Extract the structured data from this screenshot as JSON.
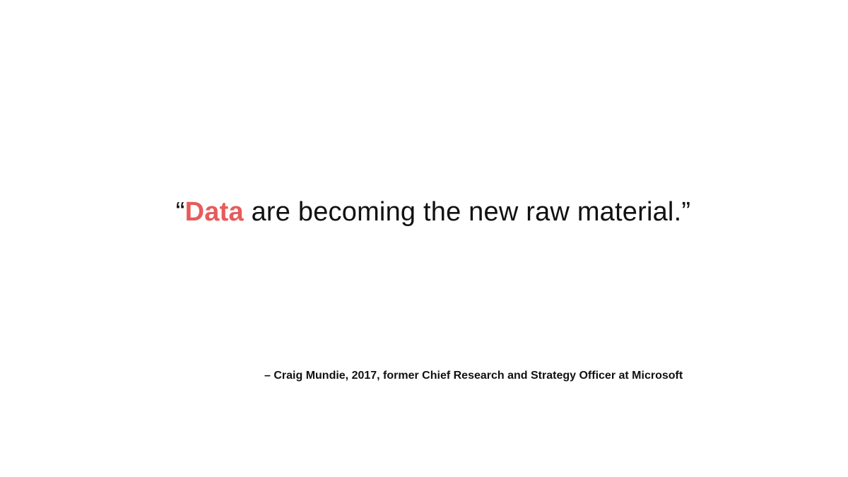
{
  "quote": {
    "open_mark": "“",
    "highlight_word": "Data",
    "rest_text": " are becoming the new raw material.",
    "close_mark": "”",
    "highlight_color": "#e85b5b"
  },
  "attribution": {
    "text": "– Craig Mundie, 2017, former Chief Research and Strategy Officer at Microsoft"
  }
}
